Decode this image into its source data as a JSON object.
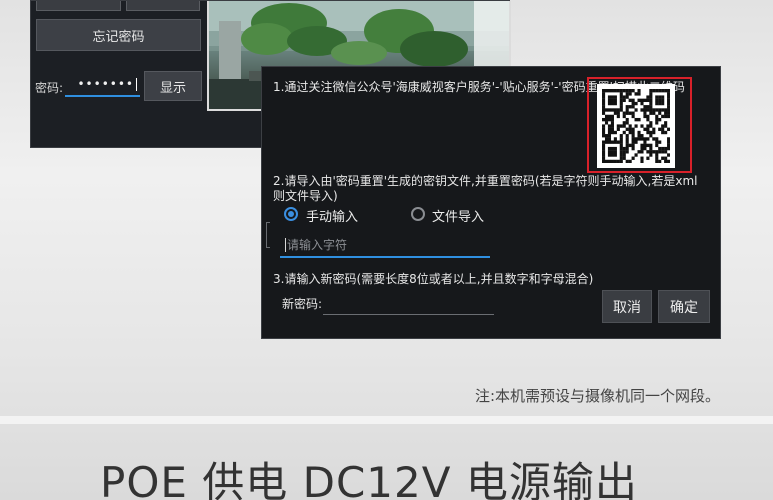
{
  "login_panel": {
    "forgot_password_label": "忘记密码",
    "password_label": "密码:",
    "password_value": "•••••••",
    "show_label": "显示"
  },
  "dialog": {
    "step1_text": "1.通过关注微信公众号'海康威视客户服务'-'贴心服务'-'密码重置'扫描此二维码",
    "step2_text": "2.请导入由'密码重置'生成的密钥文件,并重置密码(若是字符则手动输入,若是xml则文件导入)",
    "radio_manual_label": "手动输入",
    "radio_file_label": "文件导入",
    "char_input_placeholder": "请输入字符",
    "step3_text": "3.请输入新密码(需要长度8位或者以上,并且数字和字母混合)",
    "new_password_label": "新密码:",
    "cancel_label": "取消",
    "confirm_label": "确定"
  },
  "note_text": "注:本机需预设与摄像机同一个网段。",
  "headline_text": "POE 供电 DC12V 电源输出",
  "colors": {
    "accent_blue": "#2f8fe0",
    "qr_highlight_red": "#d8212a",
    "dialog_bg": "#16181b"
  }
}
